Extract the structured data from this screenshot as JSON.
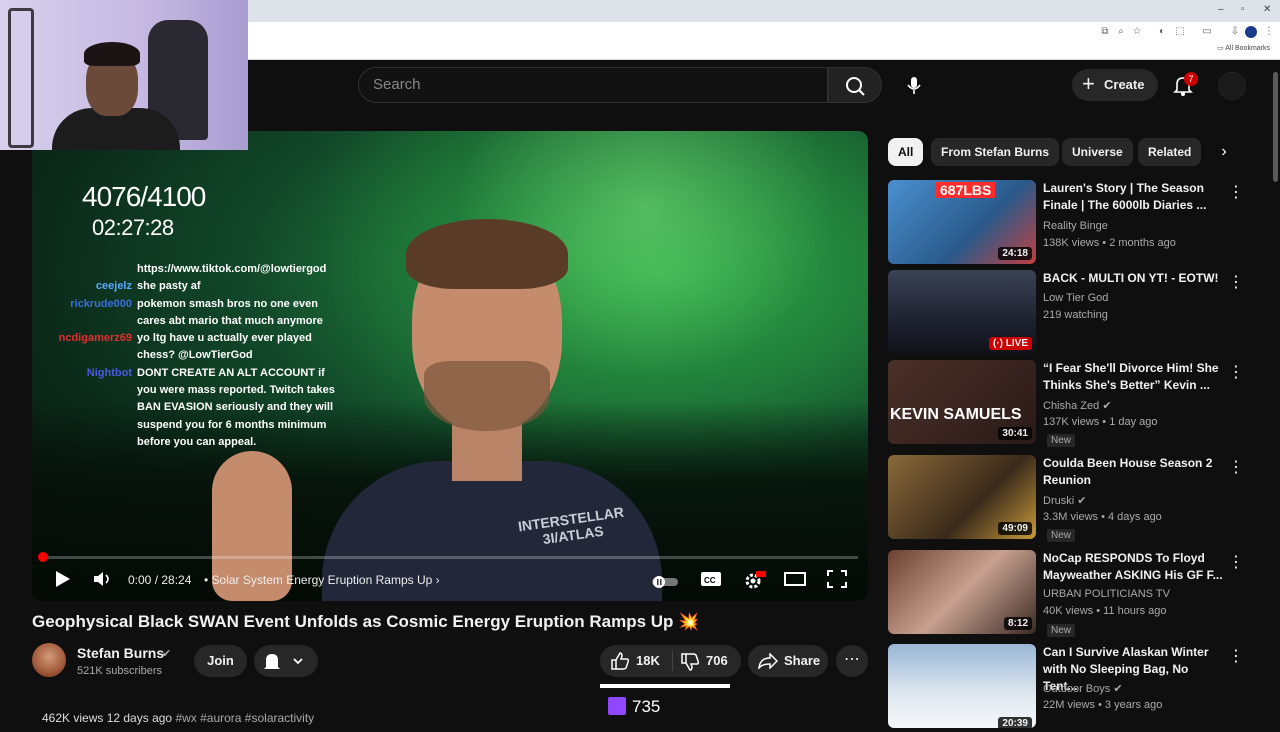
{
  "browser": {
    "bookmarks_label": "All Bookmarks",
    "window_controls": [
      "–",
      "▫",
      "✕"
    ]
  },
  "header": {
    "search_placeholder": "Search",
    "create_label": "Create",
    "notification_count": "7"
  },
  "player": {
    "counter": "4076/4100",
    "timer": "02:27:28",
    "time_display": "0:00 / 28:24",
    "chapter": "• Solar System Energy Eruption Ramps Up",
    "shirt_text": "INTERSTELLAR 3I/ATLAS",
    "progress_fraction": 0.0,
    "chat": [
      {
        "user": "",
        "message": "https://www.tiktok.com/@lowtiergod",
        "color": "#ffffff"
      },
      {
        "user": "ceejelz",
        "message": "she pasty af",
        "color": "#5aa9ff"
      },
      {
        "user": "rickrude000",
        "message": "pokemon smash bros no one even cares abt mario that much anymore",
        "color": "#3a6fd8"
      },
      {
        "user": "ncdigamerz69",
        "message": "yo ltg have u actually ever played chess? @LowTierGod",
        "color": "#e03030"
      },
      {
        "user": "Nightbot",
        "message": "DONT CREATE AN ALT ACCOUNT if you were mass reported. Twitch takes BAN EVASION seriously and they will suspend you for 6 months minimum before you can appeal.",
        "color": "#4a5ae0"
      }
    ]
  },
  "video": {
    "title": "Geophysical Black SWAN Event Unfolds as Cosmic Energy Eruption Ramps Up",
    "title_emoji": "💥",
    "channel": "Stefan Burns",
    "subscribers": "521K subscribers",
    "join_label": "Join",
    "likes": "18K",
    "dislikes": "706",
    "share_label": "Share",
    "views_date": "462K views  12 days ago",
    "tags": "#wx  #aurora  #solaractivity"
  },
  "overlay": {
    "twitch_viewers": "735"
  },
  "chips": {
    "items": [
      "All",
      "From Stefan Burns",
      "Universe",
      "Related"
    ]
  },
  "recommendations": [
    {
      "title": "Lauren's Story | The Season Finale | The 6000lb Diaries ...",
      "channel": "Reality Binge",
      "verified": false,
      "meta": "138K views • 2 months ago",
      "duration": "24:18",
      "live": false,
      "is_new": false,
      "thumb_color": "#3a7fc4",
      "thumb_text": "687LBS"
    },
    {
      "title": "BACK - MULTI ON YT! - EOTW!",
      "channel": "Low Tier God",
      "verified": false,
      "meta": "219 watching",
      "duration": "LIVE",
      "live": true,
      "is_new": false,
      "thumb_color": "#2a2e3a",
      "thumb_text": ""
    },
    {
      "title": "“I Fear She'll Divorce Him! She Thinks She's Better” Kevin ...",
      "channel": "Chisha Zed",
      "verified": true,
      "meta": "137K views • 1 day ago",
      "duration": "30:41",
      "live": false,
      "is_new": true,
      "new_label": "New",
      "thumb_color": "#3a2a28",
      "thumb_text": "KEVIN SAMUELS"
    },
    {
      "title": "Coulda Been House Season 2 Reunion",
      "channel": "Druski",
      "verified": true,
      "meta": "3.3M views • 4 days ago",
      "duration": "49:09",
      "live": false,
      "is_new": true,
      "new_label": "New",
      "thumb_color": "#6a4a2a",
      "thumb_text": ""
    },
    {
      "title": "NoCap RESPONDS To Floyd Mayweather ASKING His GF F...",
      "channel": "URBAN POLITICIANS TV",
      "verified": false,
      "meta": "40K views • 11 hours ago",
      "duration": "8:12",
      "live": false,
      "is_new": true,
      "new_label": "New",
      "thumb_color": "#5a3a2a",
      "thumb_text": ""
    },
    {
      "title": "Can I Survive Alaskan Winter with No Sleeping Bag, No Tent...",
      "channel": "Outdoor Boys",
      "verified": true,
      "meta": "22M views • 3 years ago",
      "duration": "20:39",
      "live": false,
      "is_new": false,
      "thumb_color": "#b8c8d8",
      "thumb_text": ""
    }
  ]
}
